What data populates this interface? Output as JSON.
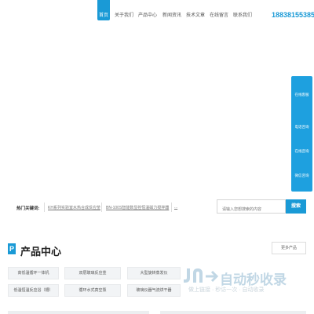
{
  "header": {
    "nav": [
      "首页",
      "关于我们",
      "产品中心",
      "新闻资讯",
      "技术文章",
      "在线留言",
      "联系我们"
    ],
    "active_index": 0,
    "phone": "18838155385"
  },
  "side_service": [
    "在线客服",
    "电话咨询",
    "在线咨询",
    "微信咨询"
  ],
  "hot_keywords": {
    "label": "热门关键词:",
    "links": [
      "KH系列实验室水热合成反应釜",
      "BN-100S智能数显控恒温磁力搅拌器",
      "..."
    ]
  },
  "search": {
    "placeholder": "请输入您想搜索的内容",
    "button": "搜索"
  },
  "products": {
    "icon_letter": "P",
    "title": "产品中心",
    "more": "更多产品",
    "categories_row1": [
      "高低温循环一体机",
      "双层玻璃反应釜",
      "大型旋转蒸发仪"
    ],
    "categories_row2": [
      "低温恒温反应浴（槽）",
      "循环水式真空泵",
      "玻璃仪器气流烘干器"
    ]
  },
  "watermark": {
    "title": "自动秒收录",
    "subtitle": "做上链接 · 秒访一次 · 自动收录"
  },
  "colors": {
    "accent": "#1a9ad6",
    "side_bar": "#1ea0df"
  }
}
